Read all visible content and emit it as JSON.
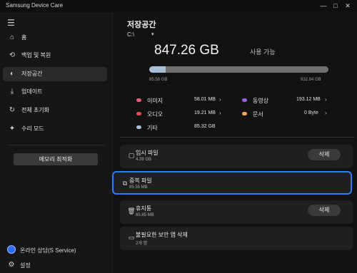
{
  "window": {
    "title": "Samsung Device Care",
    "minimize_glyph": "—",
    "maximize_glyph": "□",
    "close_glyph": "✕"
  },
  "sidebar": {
    "menu_icon": "hamburger-icon",
    "items": [
      {
        "label": "홈",
        "icon": "home-icon"
      },
      {
        "label": "백업 및 복원",
        "icon": "backup-restore-icon"
      },
      {
        "label": "저장공간",
        "icon": "storage-icon",
        "active": true
      },
      {
        "label": "업데이트",
        "icon": "download-icon"
      },
      {
        "label": "전체 초기화",
        "icon": "reset-icon"
      },
      {
        "label": "수리 모드",
        "icon": "wrench-icon"
      }
    ],
    "memory_button_label": "메모리 최적화",
    "support_label": "온라인 상담(S Service)",
    "settings_label": "설정"
  },
  "storage": {
    "title": "저장공간",
    "drive": {
      "value": "C:\\",
      "chevron": "▾"
    },
    "used_value": "847.26 GB",
    "used_suffix": "사용 가능",
    "bar": {
      "fill_fraction": 0.0919,
      "min_label": "85.58 GB",
      "max_label": "932.84 GB",
      "fill_color": "#a8bfd7",
      "track_color": "#6f6f6f"
    },
    "categories": [
      {
        "label": "이미지",
        "value": "58.01 MB",
        "chevron": "›",
        "color": "#e85a7d"
      },
      {
        "label": "동영상",
        "value": "193.12 MB",
        "chevron": "›",
        "color": "#9b5fe0"
      },
      {
        "label": "오디오",
        "value": "19.21 MB",
        "chevron": "›",
        "color": "#e05050"
      },
      {
        "label": "문서",
        "value": "0 Byte",
        "chevron": "›",
        "color": "#f0a15a"
      },
      {
        "label": "기타",
        "value": "85.32 GB",
        "chevron": "",
        "color": "#a8bfd7"
      }
    ]
  },
  "cleanup": [
    {
      "title": "임시 파일",
      "sub": "4.39 GB",
      "button": "삭제",
      "icon": "temp-file-icon"
    },
    {
      "title": "중복 파일",
      "sub": "85.55 MB",
      "button": "",
      "icon": "duplicate-file-icon",
      "selected": true
    },
    {
      "title": "휴지통",
      "sub": "65.85 MB",
      "button": "삭제",
      "icon": "trash-icon"
    },
    {
      "title": "불필요한 보안 앱 삭제",
      "sub": "2개 앱",
      "button": "",
      "icon": "security-app-icon"
    }
  ]
}
